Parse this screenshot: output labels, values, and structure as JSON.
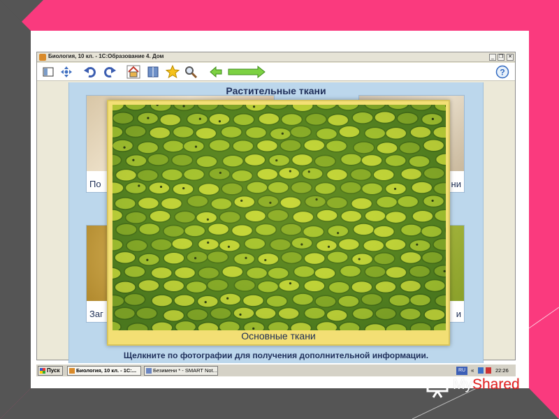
{
  "window": {
    "title": "Биология, 10 кл. - 1С:Образование 4. Дом",
    "minimize": "_",
    "restore": "❐",
    "close": "✕"
  },
  "toolbar": {
    "icons": [
      "contents-icon",
      "navigate-icon",
      "undo-icon",
      "redo-icon",
      "home-icon",
      "book-icon",
      "star-icon",
      "search-icon",
      "back-arrow-icon",
      "forward-arrow-icon",
      "help-icon"
    ]
  },
  "content": {
    "title": "Растительные ткани",
    "tiles": [
      {
        "caption": "По"
      },
      {
        "caption": "ни"
      },
      {
        "caption": "Заг"
      },
      {
        "caption": "и"
      }
    ],
    "hint": "Щелкните по фотографии для получения дополнительной информации."
  },
  "popup": {
    "caption": "Основные ткани"
  },
  "taskbar": {
    "start": "Пуск",
    "tasks": [
      {
        "label": "Биология, 10 кл. - 1С:..."
      },
      {
        "label": "Безимени * - SMART Not..."
      }
    ],
    "lang": "RU",
    "tray": "«",
    "clock": "22:26"
  },
  "watermark": {
    "brand_a": "My",
    "brand_b": "Shared"
  },
  "colors": {
    "slide_pink": "#fa3a7e",
    "slide_gray": "#555555",
    "content_blue": "#bcd7ec",
    "popup_frame": "#f3df74",
    "tissue_green": "#8fb82a"
  }
}
